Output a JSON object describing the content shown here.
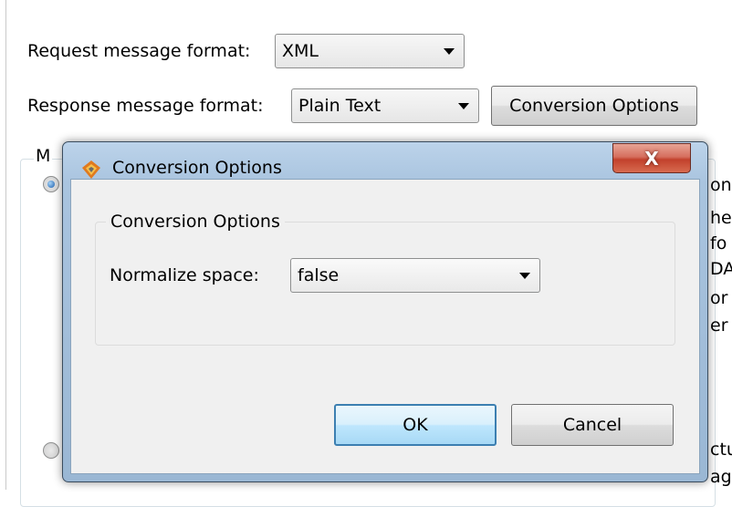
{
  "background": {
    "request_label": "Request message format:",
    "request_value": "XML",
    "response_label": "Response message format:",
    "response_value": "Plain Text",
    "conversion_options_button": "Conversion Options",
    "group_label_partial": "M",
    "peek_text": [
      "on",
      "hes",
      "fo",
      "DA",
      "or",
      "er i",
      "ctu",
      "ag"
    ]
  },
  "dialog": {
    "title": "Conversion Options",
    "close_label": "X",
    "group_label": "Conversion Options",
    "normalize_label": "Normalize space:",
    "normalize_value": "false",
    "ok_label": "OK",
    "cancel_label": "Cancel"
  }
}
